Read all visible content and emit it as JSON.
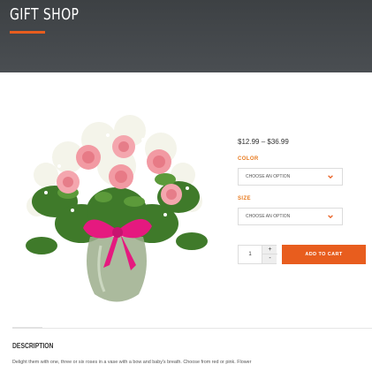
{
  "header": {
    "title": "GIFT SHOP",
    "accent_color": "#e85d1e",
    "background_color": "#45494c"
  },
  "product": {
    "image_alt": "Pink roses in a glass vase with baby's breath and a pink bow",
    "price_range": "$12.99 – $36.99",
    "color_label": "COLOR",
    "color_select": {
      "selected": "CHOOSE AN OPTION",
      "icon": "chevron-down-icon"
    },
    "size_label": "SIZE",
    "size_select": {
      "selected": "CHOOSE AN OPTION",
      "icon": "chevron-down-icon"
    },
    "quantity": "1",
    "qty_plus": "+",
    "qty_minus": "-",
    "add_to_cart": "ADD TO CART",
    "button_color": "#e85d1e"
  },
  "description": {
    "heading": "DESCRIPTION",
    "text": "Delight them with one, three or six roses in a vase with a bow and baby's breath. Choose from red or pink. Flower"
  }
}
